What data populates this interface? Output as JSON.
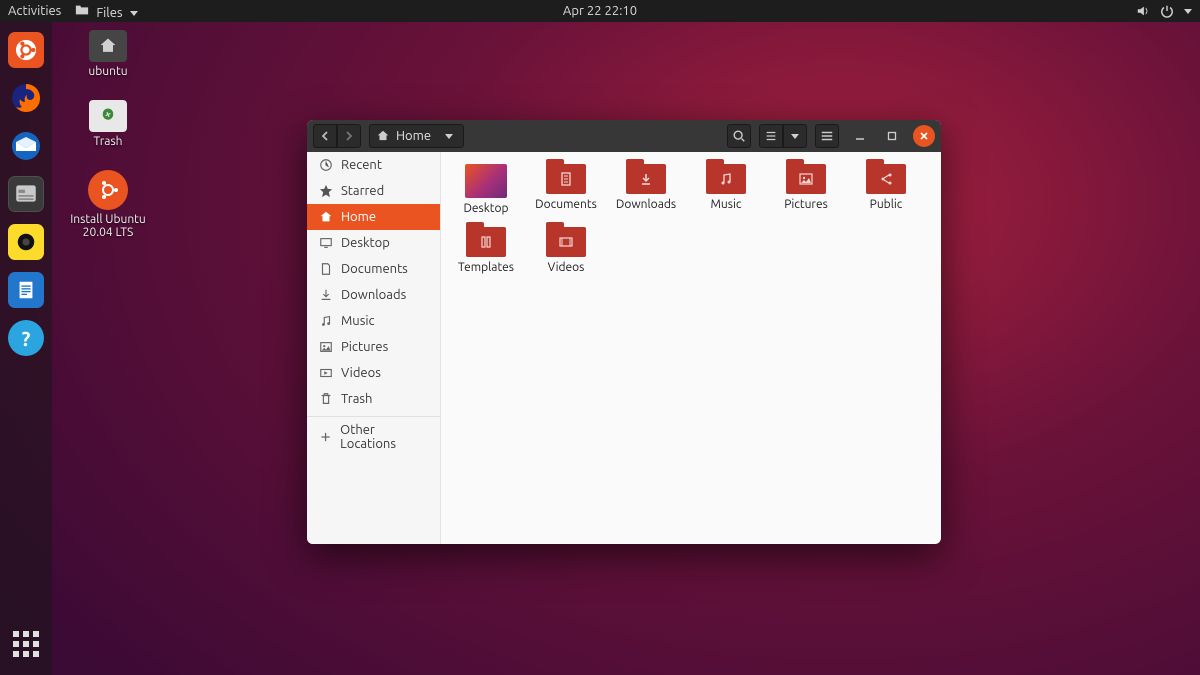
{
  "topbar": {
    "activities": "Activities",
    "app_menu": "Files",
    "clock": "Apr 22  22:10"
  },
  "desktop_icons": {
    "home": "ubuntu",
    "trash": "Trash",
    "installer_line1": "Install Ubuntu",
    "installer_line2": "20.04 LTS"
  },
  "files_window": {
    "path_label": "Home",
    "sidebar": {
      "recent": "Recent",
      "starred": "Starred",
      "home": "Home",
      "desktop": "Desktop",
      "documents": "Documents",
      "downloads": "Downloads",
      "music": "Music",
      "pictures": "Pictures",
      "videos": "Videos",
      "trash": "Trash",
      "other": "Other Locations"
    },
    "folders": {
      "desktop": "Desktop",
      "documents": "Documents",
      "downloads": "Downloads",
      "music": "Music",
      "pictures": "Pictures",
      "public": "Public",
      "templates": "Templates",
      "videos": "Videos"
    }
  }
}
